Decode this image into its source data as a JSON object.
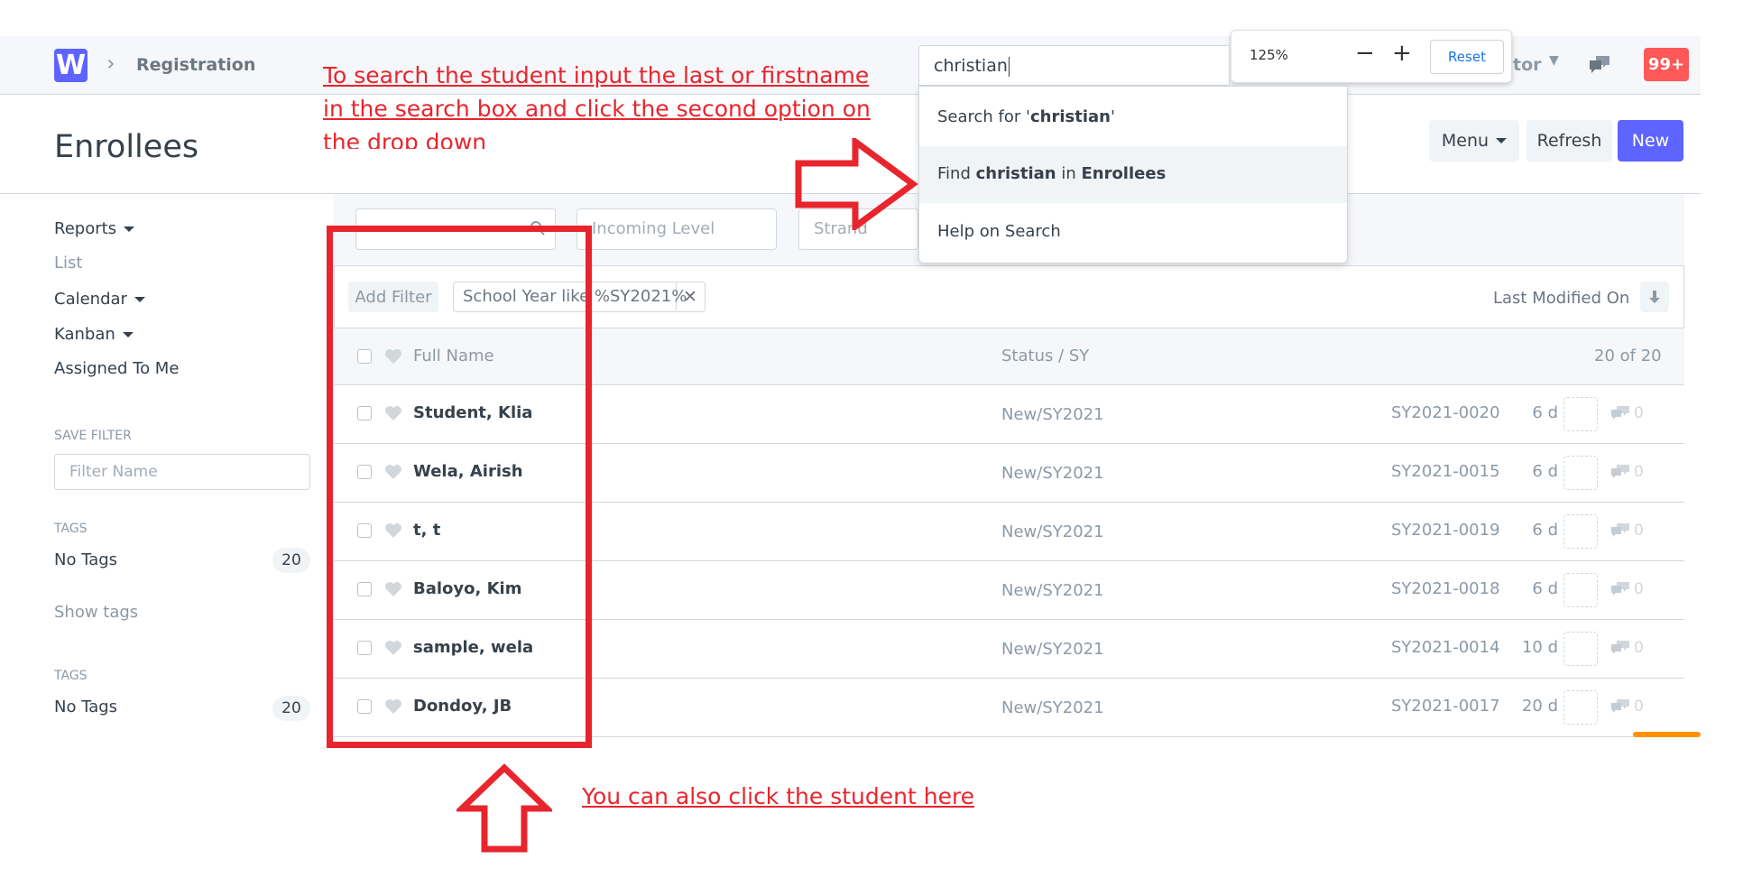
{
  "navbar": {
    "logo_letter": "W",
    "breadcrumb": "Registration",
    "user_menu_fragment": "tor",
    "notification_count": "99+"
  },
  "page": {
    "title": "Enrollees",
    "buttons": {
      "menu": "Menu",
      "refresh": "Refresh",
      "new": "New"
    }
  },
  "sidebar": {
    "reports": "Reports",
    "list": "List",
    "calendar": "Calendar",
    "kanban": "Kanban",
    "assigned_to_me": "Assigned To Me",
    "save_filter_heading": "SAVE FILTER",
    "filter_name_placeholder": "Filter Name",
    "tags_heading_1": "TAGS",
    "no_tags_1": "No Tags",
    "no_tags_count_1": "20",
    "show_tags": "Show tags",
    "tags_heading_2": "TAGS",
    "no_tags_2": "No Tags",
    "no_tags_count_2": "20"
  },
  "filters": {
    "incoming_level_placeholder": "Incoming Level",
    "strand_placeholder": "Strand",
    "add_filter": "Add Filter",
    "active_filter": "School Year like %SY2021%",
    "sort_label": "Last Modified On"
  },
  "list": {
    "col_full_name": "Full Name",
    "col_status": "Status / SY",
    "count_label": "20 of 20",
    "rows": [
      {
        "name": "Student, Klia",
        "status": "New/SY2021",
        "id": "SY2021-0020",
        "age": "6 d",
        "comments": "0"
      },
      {
        "name": "Wela, Airish",
        "status": "New/SY2021",
        "id": "SY2021-0015",
        "age": "6 d",
        "comments": "0"
      },
      {
        "name": "t, t",
        "status": "New/SY2021",
        "id": "SY2021-0019",
        "age": "6 d",
        "comments": "0"
      },
      {
        "name": "Baloyo, Kim",
        "status": "New/SY2021",
        "id": "SY2021-0018",
        "age": "6 d",
        "comments": "0"
      },
      {
        "name": "sample, wela",
        "status": "New/SY2021",
        "id": "SY2021-0014",
        "age": "10 d",
        "comments": "0"
      },
      {
        "name": "Dondoy, JB",
        "status": "New/SY2021",
        "id": "SY2021-0017",
        "age": "20 d",
        "comments": "0"
      }
    ]
  },
  "search": {
    "value": "christian",
    "opt_search_prefix": "Search for '",
    "opt_search_term": "christian",
    "opt_search_suffix": "'",
    "opt_find_prefix": "Find ",
    "opt_find_term": "christian",
    "opt_find_mid": " in ",
    "opt_find_doctype": "Enrollees",
    "opt_help": "Help on Search"
  },
  "zoom": {
    "level": "125%",
    "minus": "−",
    "plus": "+",
    "reset": "Reset"
  },
  "annotations": {
    "top_line1": "To search the student input the last or firstname",
    "top_line2": "in the search box and click the second option on",
    "top_line3": "the drop down",
    "bottom": "You can also click the student here",
    "color": "#e8252d"
  }
}
